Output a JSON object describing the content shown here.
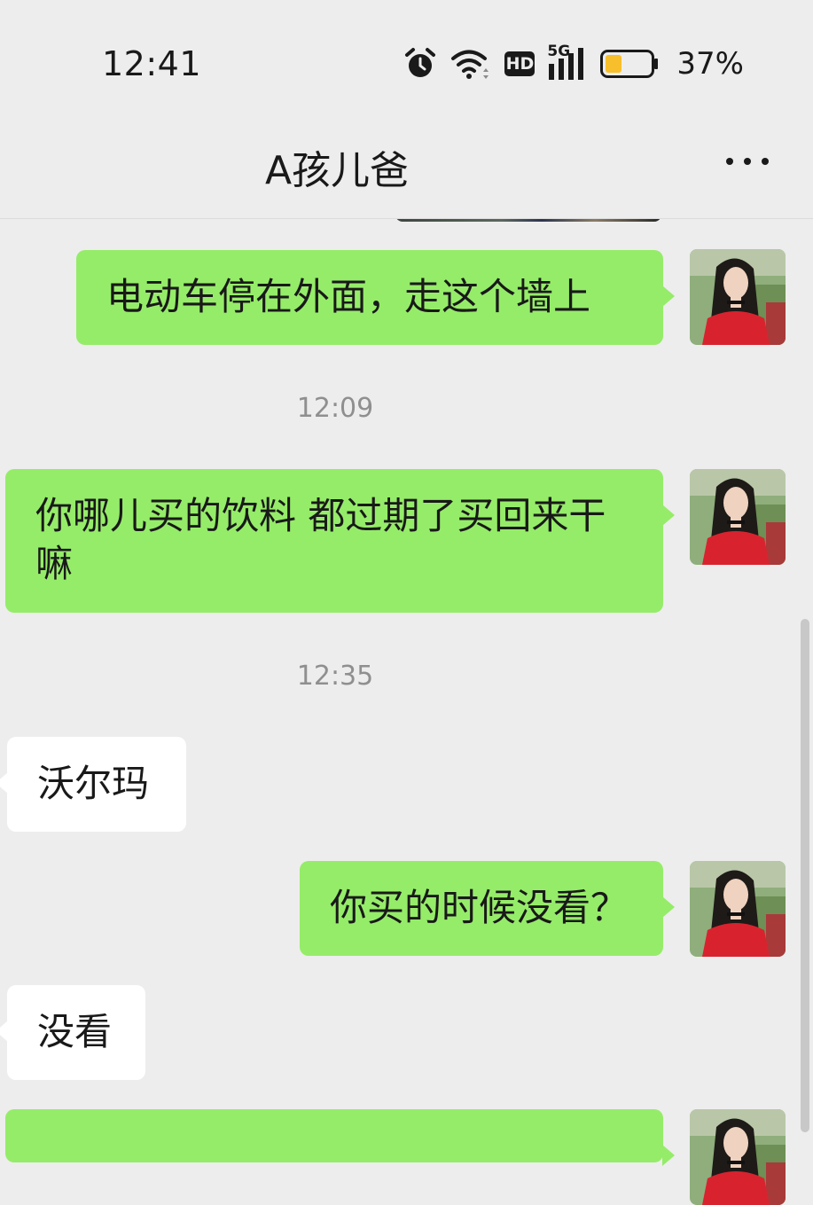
{
  "status": {
    "time": "12:41",
    "network": "5G",
    "hd": "HD",
    "battery": "37%",
    "battery_level": 0.37
  },
  "header": {
    "title": "A孩儿爸"
  },
  "messages": [
    {
      "side": "self",
      "text": "电动车停在外面，走这个墙上"
    },
    {
      "type": "time",
      "text": "12:09"
    },
    {
      "side": "self",
      "text": "你哪儿买的饮料  都过期了买回来干嘛"
    },
    {
      "type": "time",
      "text": "12:35"
    },
    {
      "side": "other",
      "text": "沃尔玛"
    },
    {
      "side": "self",
      "text": "你买的时候没看？"
    },
    {
      "side": "other",
      "text": "没看"
    }
  ],
  "colors": {
    "self_bubble": "#95ec69",
    "other_bubble": "#ffffff",
    "background": "#ededed"
  },
  "icons": [
    "alarm-icon",
    "wifi-icon",
    "hd-icon",
    "signal-5g-icon",
    "battery-icon",
    "more-icon"
  ]
}
